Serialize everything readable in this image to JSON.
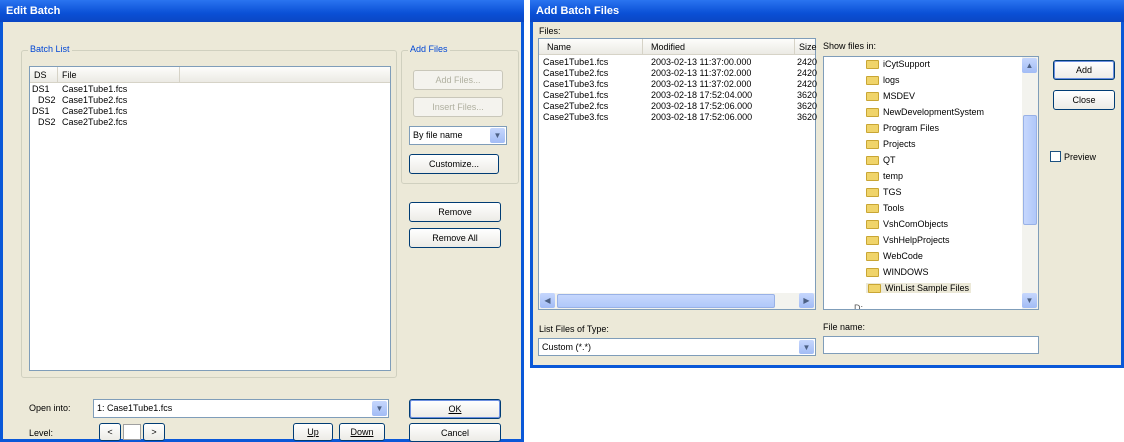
{
  "edit_batch": {
    "title": "Edit Batch",
    "batch_list": {
      "group_label": "Batch List",
      "columns": [
        "DS",
        "File"
      ],
      "rows": [
        {
          "ds": "DS1",
          "file": "Case1Tube1.fcs"
        },
        {
          "ds": "DS2",
          "file": "Case1Tube2.fcs"
        },
        {
          "ds": "DS1",
          "file": "Case2Tube1.fcs"
        },
        {
          "ds": "DS2",
          "file": "Case2Tube2.fcs"
        }
      ]
    },
    "add_files": {
      "group_label": "Add Files",
      "add_files_button": "Add Files...",
      "insert_files_button": "Insert Files...",
      "sort_select": "By file name",
      "customize_button": "Customize..."
    },
    "remove_button": "Remove",
    "remove_all_button": "Remove All",
    "open_into_label": "Open into:",
    "open_into_value": "1: Case1Tube1.fcs",
    "level_label": "Level:",
    "level_prev": "<",
    "level_next": ">",
    "up_button": "Up",
    "down_button": "Down",
    "ok_button": "OK",
    "cancel_button": "Cancel"
  },
  "add_batch_files": {
    "title": "Add Batch Files",
    "files_label": "Files:",
    "columns": [
      "Name",
      "Modified",
      "Size"
    ],
    "files": [
      {
        "name": "Case1Tube1.fcs",
        "modified": "2003-02-13 11:37:00.000",
        "size": "2420"
      },
      {
        "name": "Case1Tube2.fcs",
        "modified": "2003-02-13 11:37:02.000",
        "size": "2420"
      },
      {
        "name": "Case1Tube3.fcs",
        "modified": "2003-02-13 11:37:02.000",
        "size": "2420"
      },
      {
        "name": "Case2Tube1.fcs",
        "modified": "2003-02-18 17:52:04.000",
        "size": "3620"
      },
      {
        "name": "Case2Tube2.fcs",
        "modified": "2003-02-18 17:52:06.000",
        "size": "3620"
      },
      {
        "name": "Case2Tube3.fcs",
        "modified": "2003-02-18 17:52:06.000",
        "size": "3620"
      }
    ],
    "show_files_in_label": "Show files in:",
    "folders": [
      "iCytSupport",
      "logs",
      "MSDEV",
      "NewDevelopmentSystem",
      "Program Files",
      "Projects",
      "QT",
      "temp",
      "TGS",
      "Tools",
      "VshComObjects",
      "VshHelpProjects",
      "WebCode",
      "WINDOWS",
      "WinList Sample Files"
    ],
    "tree_partial": "D:",
    "add_button": "Add",
    "close_button": "Close",
    "preview_label": "Preview",
    "list_type_label": "List Files of Type:",
    "list_type_value": "Custom (*.*)",
    "file_name_label": "File name:",
    "file_name_value": ""
  }
}
